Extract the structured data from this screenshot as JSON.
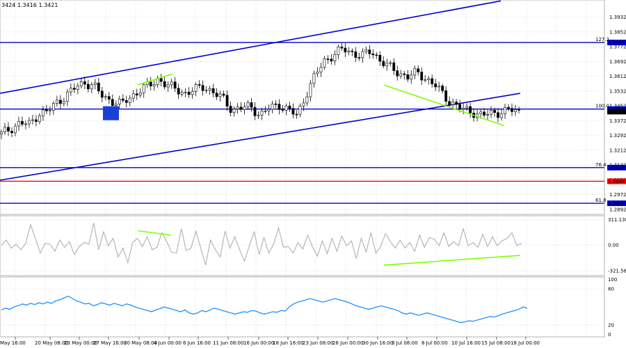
{
  "header": {
    "text": "3424 1.3416 1.3421"
  },
  "chart_data": [
    {
      "type": "candlestick",
      "panel": "price",
      "ylim": [
        1.2865,
        1.4025
      ],
      "y_ticks": [
        "1.3932",
        "1.3852",
        "1.3772",
        "1.3692",
        "1.3612",
        "1.3532",
        "1.3452",
        "1.3372",
        "1.3292",
        "1.3212",
        "1.3132",
        "1.3052",
        "1.2972",
        "1.2892"
      ],
      "close_path": [
        1.33,
        1.333,
        1.336,
        1.335,
        1.341,
        1.342,
        1.347,
        1.351,
        1.355,
        1.358,
        1.356,
        1.35,
        1.348,
        1.346,
        1.35,
        1.354,
        1.356,
        1.36,
        1.356,
        1.354,
        1.352,
        1.354,
        1.356,
        1.352,
        1.349,
        1.343,
        1.344,
        1.345,
        1.34,
        1.344,
        1.346,
        1.343,
        1.34,
        1.352,
        1.362,
        1.37,
        1.373,
        1.376,
        1.374,
        1.372,
        1.375,
        1.37,
        1.366,
        1.363,
        1.361,
        1.363,
        1.36,
        1.356,
        1.35,
        1.346,
        1.343,
        1.342,
        1.34,
        1.341,
        1.342,
        1.343,
        1.342
      ],
      "levels": [
        {
          "value": 1.3795,
          "label": "1.3795",
          "fib": "127.2",
          "color": "#0000cd"
        },
        {
          "value": 1.3435,
          "label": "1.3435",
          "fib": "100.0",
          "color": "#0000cd"
        },
        {
          "value": 1.3421,
          "label": "1.3421",
          "fib": "",
          "color": "#000000"
        },
        {
          "value": 1.3118,
          "label": "1.3118",
          "fib": "76.4",
          "color": "#0000cd"
        },
        {
          "value": 1.3044,
          "label": "1.3044",
          "fib": "",
          "color": "#ff0000"
        },
        {
          "value": 1.2925,
          "label": "1.2925",
          "fib": "61.8",
          "color": "#0000cd"
        }
      ],
      "channel": {
        "upper": [
          [
            0,
            1.352
          ],
          [
            720,
            1.402
          ]
        ],
        "lower": [
          [
            0,
            1.305
          ],
          [
            748,
            1.352
          ]
        ],
        "color": "#0000cd"
      },
      "divergence_lines": [
        {
          "from": [
            198,
            1.3565
          ],
          "to": [
            248,
            1.3625
          ]
        },
        {
          "from": [
            552,
            1.3565
          ],
          "to": [
            725,
            1.3345
          ]
        }
      ]
    },
    {
      "type": "line",
      "panel": "oscillator",
      "ylim": [
        -380,
        360
      ],
      "y_ticks": [
        "311.138",
        "0.00",
        "-321.584"
      ],
      "series": [
        {
          "color": "#b0b0b0",
          "values": [
            -10,
            60,
            -40,
            10,
            -60,
            20,
            250,
            80,
            -100,
            20,
            10,
            -80,
            60,
            -30,
            40,
            -120,
            -20,
            30,
            10,
            270,
            -60,
            160,
            -10,
            80,
            -150,
            -40,
            -220,
            30,
            80,
            -20,
            100,
            -60,
            -30,
            150,
            40,
            -90,
            -100,
            200,
            -70,
            -40,
            170,
            -40,
            -250,
            60,
            -60,
            -150,
            170,
            -40,
            100,
            -60,
            -200,
            -10,
            160,
            -120,
            90,
            -100,
            10,
            210,
            -30,
            -20,
            -100,
            30,
            -50,
            120,
            -30,
            -140,
            50,
            -110,
            80,
            -80,
            110,
            -10,
            50,
            -170,
            80,
            -90,
            150,
            -100,
            -20,
            140,
            40,
            -40,
            60,
            -40,
            30,
            -80,
            120,
            -30,
            90,
            70,
            -10,
            150,
            -20,
            40,
            -10,
            200,
            -10,
            30,
            -30,
            130,
            -20,
            100,
            -10,
            50,
            80,
            150,
            -10,
            20
          ]
        }
      ],
      "divergence_lines": [
        {
          "from": [
            198,
            175
          ],
          "to": [
            246,
            120
          ]
        },
        {
          "from": [
            552,
            -250
          ],
          "to": [
            748,
            -130
          ]
        }
      ]
    },
    {
      "type": "line",
      "panel": "rsi",
      "ylim": [
        0,
        100
      ],
      "y_ticks": [
        "100",
        "80",
        "20",
        "0"
      ],
      "levels": [
        80,
        20
      ],
      "series": [
        {
          "color": "#1e90ff",
          "values": [
            45,
            48,
            46,
            50,
            52,
            55,
            53,
            56,
            54,
            57,
            55,
            58,
            56,
            60,
            62,
            65,
            68,
            64,
            60,
            58,
            55,
            56,
            52,
            54,
            57,
            55,
            53,
            56,
            54,
            52,
            55,
            53,
            50,
            48,
            46,
            44,
            42,
            45,
            47,
            50,
            48,
            46,
            44,
            42,
            45,
            40,
            38,
            40,
            44,
            42,
            45,
            48,
            46,
            44,
            42,
            40,
            38,
            40,
            42,
            41,
            44,
            43,
            40,
            38,
            40,
            42,
            41,
            44,
            43,
            50,
            55,
            58,
            60,
            62,
            64,
            62,
            60,
            58,
            60,
            62,
            64,
            62,
            60,
            58,
            55,
            52,
            50,
            48,
            46,
            48,
            50,
            52,
            50,
            48,
            46,
            44,
            40,
            38,
            40,
            38,
            36,
            38,
            40,
            38,
            36,
            34,
            32,
            30,
            28,
            26,
            24,
            25,
            27,
            26,
            28,
            30,
            32,
            34,
            33,
            35,
            38,
            40,
            42,
            44,
            46,
            50,
            48
          ]
        }
      ]
    }
  ],
  "x_labels": [
    "May 16:00",
    "20 May 08:00",
    "23 May 00:00",
    "27 May 16:00",
    "30 May 08:00",
    "4 Jun 00:00",
    "6 Jun 16:00",
    "11 Jun 08:00",
    "16 Jun 00:00",
    "18 Jun 16:00",
    "23 Jun 08:00",
    "26 Jun 00:00",
    "30 Jun 16:00",
    "3 Jul 08:00",
    "8 Jul 00:00",
    "10 Jul 16:00",
    "15 Jul 08:00",
    "18 Jul 00:00"
  ]
}
